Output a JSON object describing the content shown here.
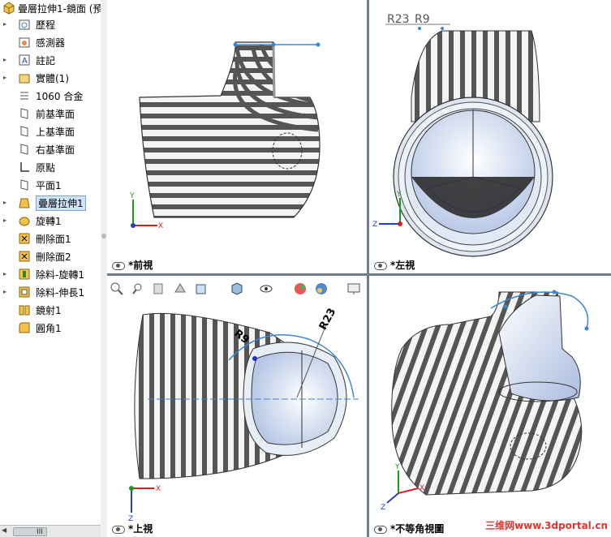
{
  "tree": {
    "title": "曡層拉伸1-鏡面 (預",
    "items": [
      {
        "label": "歷程",
        "icon": "history-icon",
        "toggle": "▸"
      },
      {
        "label": "感測器",
        "icon": "sensor-icon",
        "toggle": ""
      },
      {
        "label": "註記",
        "icon": "annotation-icon",
        "toggle": "▸"
      },
      {
        "label": "實體(1)",
        "icon": "solid-body-folder-icon",
        "toggle": "▸"
      },
      {
        "label": "1060 合金",
        "icon": "material-icon",
        "toggle": ""
      },
      {
        "label": "前基準面",
        "icon": "plane-icon",
        "toggle": ""
      },
      {
        "label": "上基準面",
        "icon": "plane-icon",
        "toggle": ""
      },
      {
        "label": "右基準面",
        "icon": "plane-icon",
        "toggle": ""
      },
      {
        "label": "原點",
        "icon": "origin-icon",
        "toggle": ""
      },
      {
        "label": "平面1",
        "icon": "plane-icon",
        "toggle": ""
      },
      {
        "label": "曡層拉伸1",
        "icon": "loft-icon",
        "toggle": "▸",
        "selected": true
      },
      {
        "label": "旋轉1",
        "icon": "revolve-icon",
        "toggle": "▸"
      },
      {
        "label": "刪除面1",
        "icon": "delete-face-icon",
        "toggle": ""
      },
      {
        "label": "刪除面2",
        "icon": "delete-face-icon",
        "toggle": ""
      },
      {
        "label": "除料-旋轉1",
        "icon": "revolve-cut-icon",
        "toggle": "▸"
      },
      {
        "label": "除料-伸長1",
        "icon": "extrude-cut-icon",
        "toggle": "▸"
      },
      {
        "label": "鏡射1",
        "icon": "mirror-icon",
        "toggle": ""
      },
      {
        "label": "圓角1",
        "icon": "fillet-icon",
        "toggle": ""
      }
    ],
    "scroll_label": "III"
  },
  "views": {
    "front": "*前視",
    "left": "*左視",
    "top": "*上視",
    "iso": "*不等角視圖"
  },
  "dims": {
    "r23": "R23",
    "r9": "R9"
  },
  "axes": {
    "x": "X",
    "y": "Y",
    "z": "Z"
  },
  "toolbar_icons": [
    "zoom-fit-icon",
    "zoom-area-icon",
    "previous-view-icon",
    "section-view-icon",
    "view-orientation-icon",
    "display-style-icon",
    "hide-show-icon",
    "appearance-icon",
    "scene-icon",
    "display-settings-icon"
  ],
  "watermark": "三维网www.3dportal.cn",
  "colors": {
    "accent": "#3a86d6",
    "sel": "#cfe3fb",
    "stripe": "#5a5a5a",
    "sep": "#6d7b8c"
  }
}
